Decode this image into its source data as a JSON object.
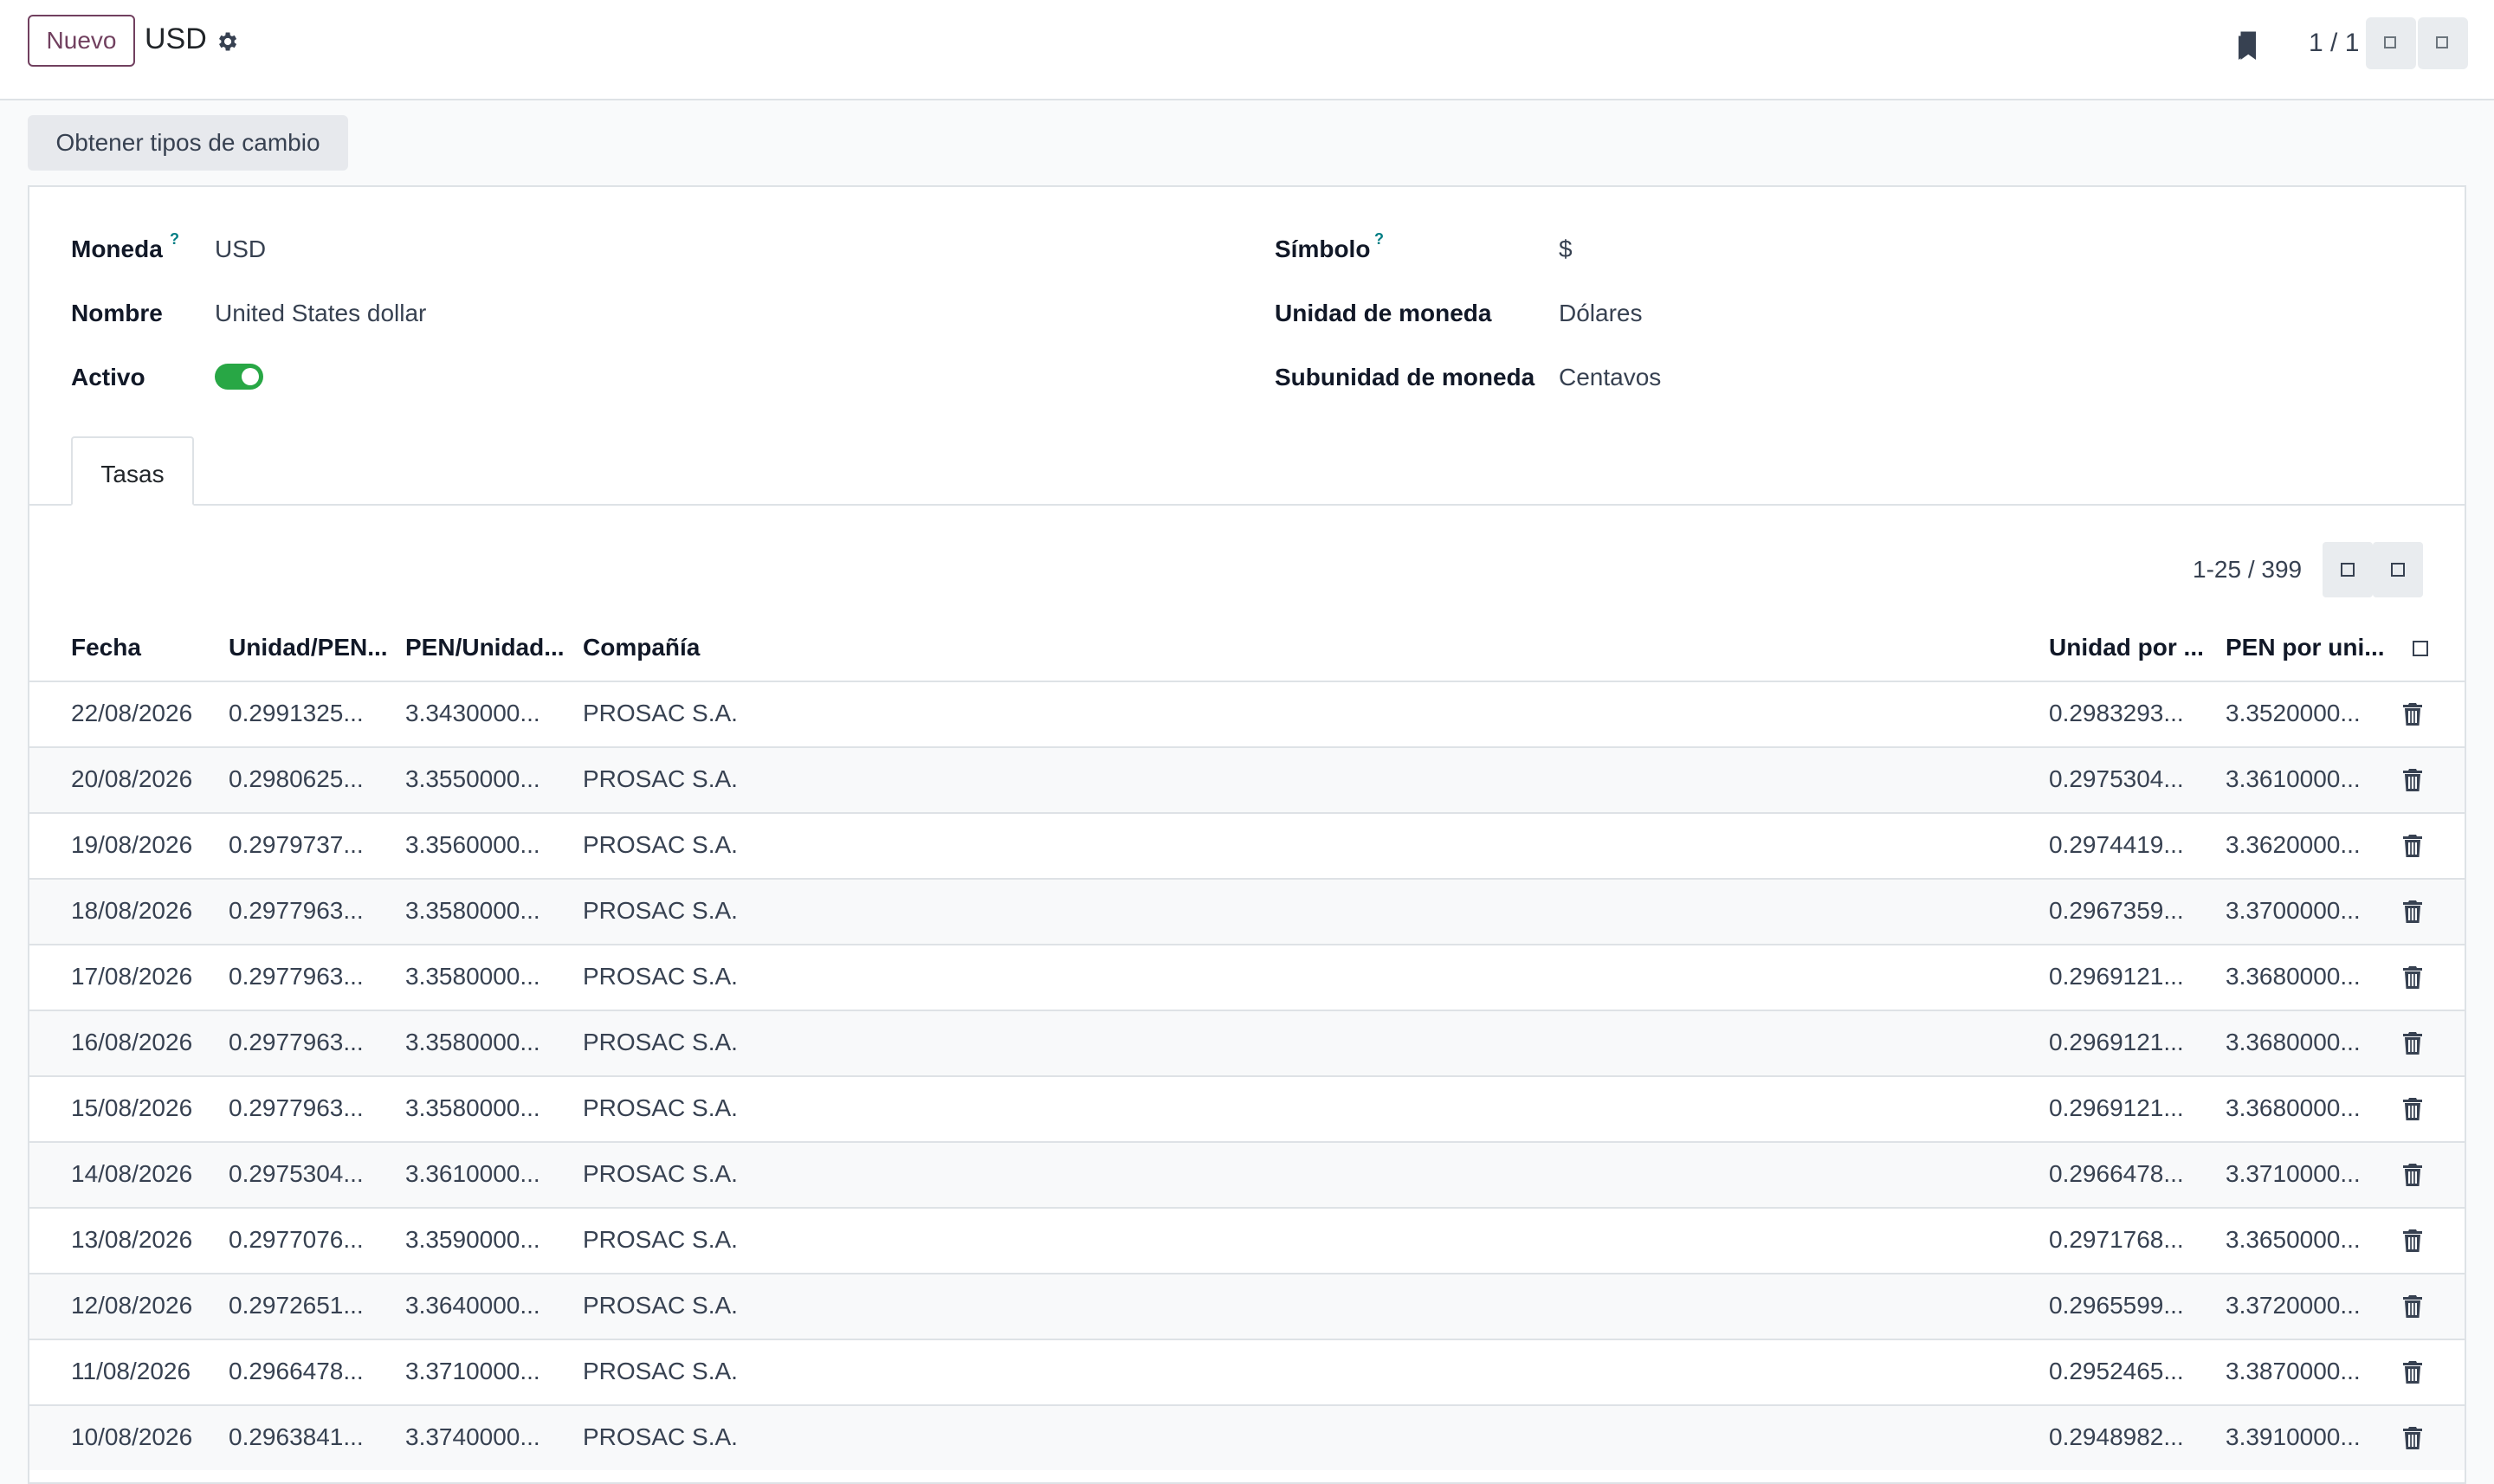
{
  "header": {
    "new_label": "Nuevo",
    "title": "USD",
    "pager": "1 / 1"
  },
  "actions": {
    "get_rates_label": "Obtener tipos de cambio"
  },
  "form": {
    "currency_label": "Moneda",
    "currency_value": "USD",
    "name_label": "Nombre",
    "name_value": "United States dollar",
    "active_label": "Activo",
    "active": true,
    "symbol_label": "Símbolo",
    "symbol_value": "$",
    "unit_label": "Unidad de moneda",
    "unit_value": "Dólares",
    "subunit_label": "Subunidad de moneda",
    "subunit_value": "Centavos",
    "help_mark": "?"
  },
  "tabs": [
    {
      "label": "Tasas",
      "active": true
    }
  ],
  "rates_list": {
    "pager": "1-25 / 399",
    "columns": [
      "Fecha",
      "Unidad/PEN...",
      "PEN/Unidad...",
      "Compañía",
      "Unidad por ...",
      "PEN por uni..."
    ],
    "rows": [
      [
        "22/08/2026",
        "0.2991325...",
        "3.3430000...",
        "PROSAC S.A.",
        "0.2983293...",
        "3.3520000..."
      ],
      [
        "20/08/2026",
        "0.2980625...",
        "3.3550000...",
        "PROSAC S.A.",
        "0.2975304...",
        "3.3610000..."
      ],
      [
        "19/08/2026",
        "0.2979737...",
        "3.3560000...",
        "PROSAC S.A.",
        "0.2974419...",
        "3.3620000..."
      ],
      [
        "18/08/2026",
        "0.2977963...",
        "3.3580000...",
        "PROSAC S.A.",
        "0.2967359...",
        "3.3700000..."
      ],
      [
        "17/08/2026",
        "0.2977963...",
        "3.3580000...",
        "PROSAC S.A.",
        "0.2969121...",
        "3.3680000..."
      ],
      [
        "16/08/2026",
        "0.2977963...",
        "3.3580000...",
        "PROSAC S.A.",
        "0.2969121...",
        "3.3680000..."
      ],
      [
        "15/08/2026",
        "0.2977963...",
        "3.3580000...",
        "PROSAC S.A.",
        "0.2969121...",
        "3.3680000..."
      ],
      [
        "14/08/2026",
        "0.2975304...",
        "3.3610000...",
        "PROSAC S.A.",
        "0.2966478...",
        "3.3710000..."
      ],
      [
        "13/08/2026",
        "0.2977076...",
        "3.3590000...",
        "PROSAC S.A.",
        "0.2971768...",
        "3.3650000..."
      ],
      [
        "12/08/2026",
        "0.2972651...",
        "3.3640000...",
        "PROSAC S.A.",
        "0.2965599...",
        "3.3720000..."
      ],
      [
        "11/08/2026",
        "0.2966478...",
        "3.3710000...",
        "PROSAC S.A.",
        "0.2952465...",
        "3.3870000..."
      ],
      [
        "10/08/2026",
        "0.2963841...",
        "3.3740000...",
        "PROSAC S.A.",
        "0.2948982...",
        "3.3910000..."
      ]
    ]
  },
  "colors": {
    "brand": "#71405f",
    "toggle_on": "#28a745",
    "help": "#017e84"
  }
}
